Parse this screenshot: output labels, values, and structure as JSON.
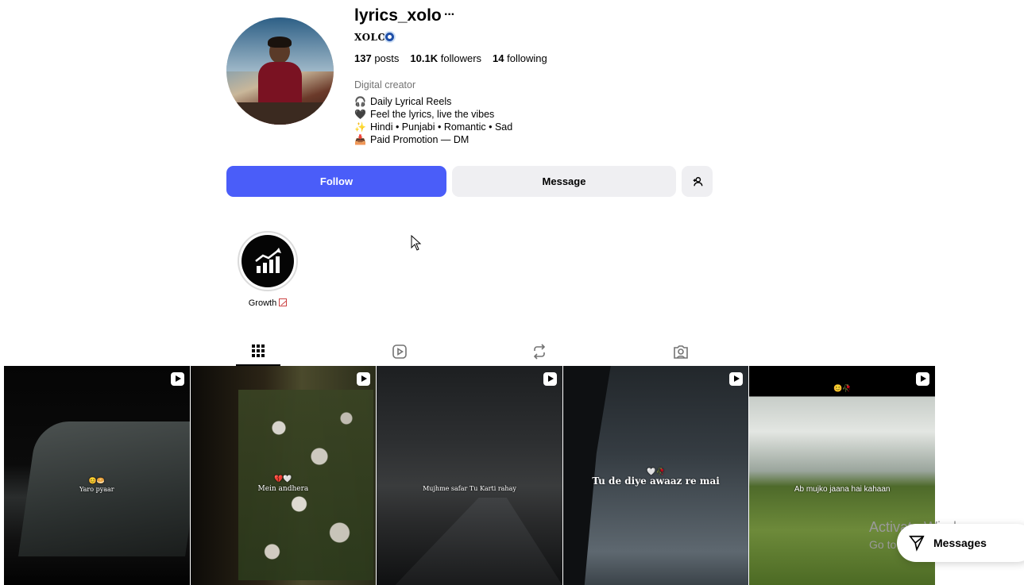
{
  "profile": {
    "username": "lyrics_xolo",
    "more_label": "···",
    "full_name": "XOLO",
    "stats": {
      "posts_count": "137",
      "posts_label": "posts",
      "followers_count": "10.1K",
      "followers_label": "followers",
      "following_count": "14",
      "following_label": "following"
    },
    "category": "Digital creator",
    "bio": [
      {
        "icon": "headphones-icon",
        "glyph": "🎧",
        "text": "Daily Lyrical Reels"
      },
      {
        "icon": "heart-icon",
        "glyph": "🖤",
        "text": "Feel the lyrics, live the vibes"
      },
      {
        "icon": "sparkles-icon",
        "glyph": "✨",
        "text": "Hindi • Punjabi • Romantic • Sad"
      },
      {
        "icon": "inbox-icon",
        "glyph": "📥",
        "text": "Paid Promotion — DM"
      }
    ]
  },
  "actions": {
    "follow_label": "Follow",
    "message_label": "Message"
  },
  "highlights": [
    {
      "label": "Growth"
    }
  ],
  "posts": [
    {
      "caption_emoji": "😊🥯",
      "caption": "Yaro pyaar"
    },
    {
      "caption_emoji": "💔🤍",
      "caption": "Mein andhera"
    },
    {
      "caption_emoji": "",
      "caption": "Mujhme safar Tu Karti rahay"
    },
    {
      "caption_emoji": "🤍🥀",
      "caption": "Tu de diye awaaz re mai"
    },
    {
      "caption_emoji": "😊🥀",
      "caption": "Ab mujko jaana hai kahaan"
    }
  ],
  "overlay": {
    "watermark_title": "Activate Windows",
    "watermark_sub": "Go to Settings to activate Windows.",
    "messages_label": "Messages"
  },
  "colors": {
    "follow_button": "#4a5df9",
    "secondary_button": "#efeff2",
    "verified_badge": "#1f4fa8"
  }
}
